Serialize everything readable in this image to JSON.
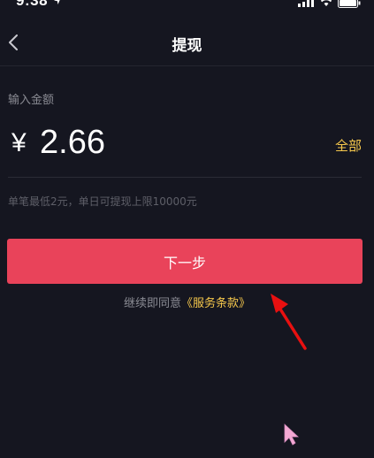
{
  "status_bar": {
    "time": "9:38"
  },
  "nav": {
    "title": "提现",
    "back_icon": "chevron-left-icon"
  },
  "amount": {
    "label": "输入金额",
    "currency_symbol": "¥",
    "value": "2.66",
    "withdraw_all": "全部"
  },
  "hint": {
    "limit_text": "单笔最低2元，单日可提现上限10000元"
  },
  "actions": {
    "next_label": "下一步"
  },
  "terms": {
    "prefix": "继续即同意",
    "link": "《服务条款》"
  },
  "colors": {
    "background": "#151620",
    "primary_button": "#e9435a",
    "accent_gold": "#f6c84c",
    "annotation_red": "#e81010",
    "cursor_pink": "#f3a9d3"
  }
}
